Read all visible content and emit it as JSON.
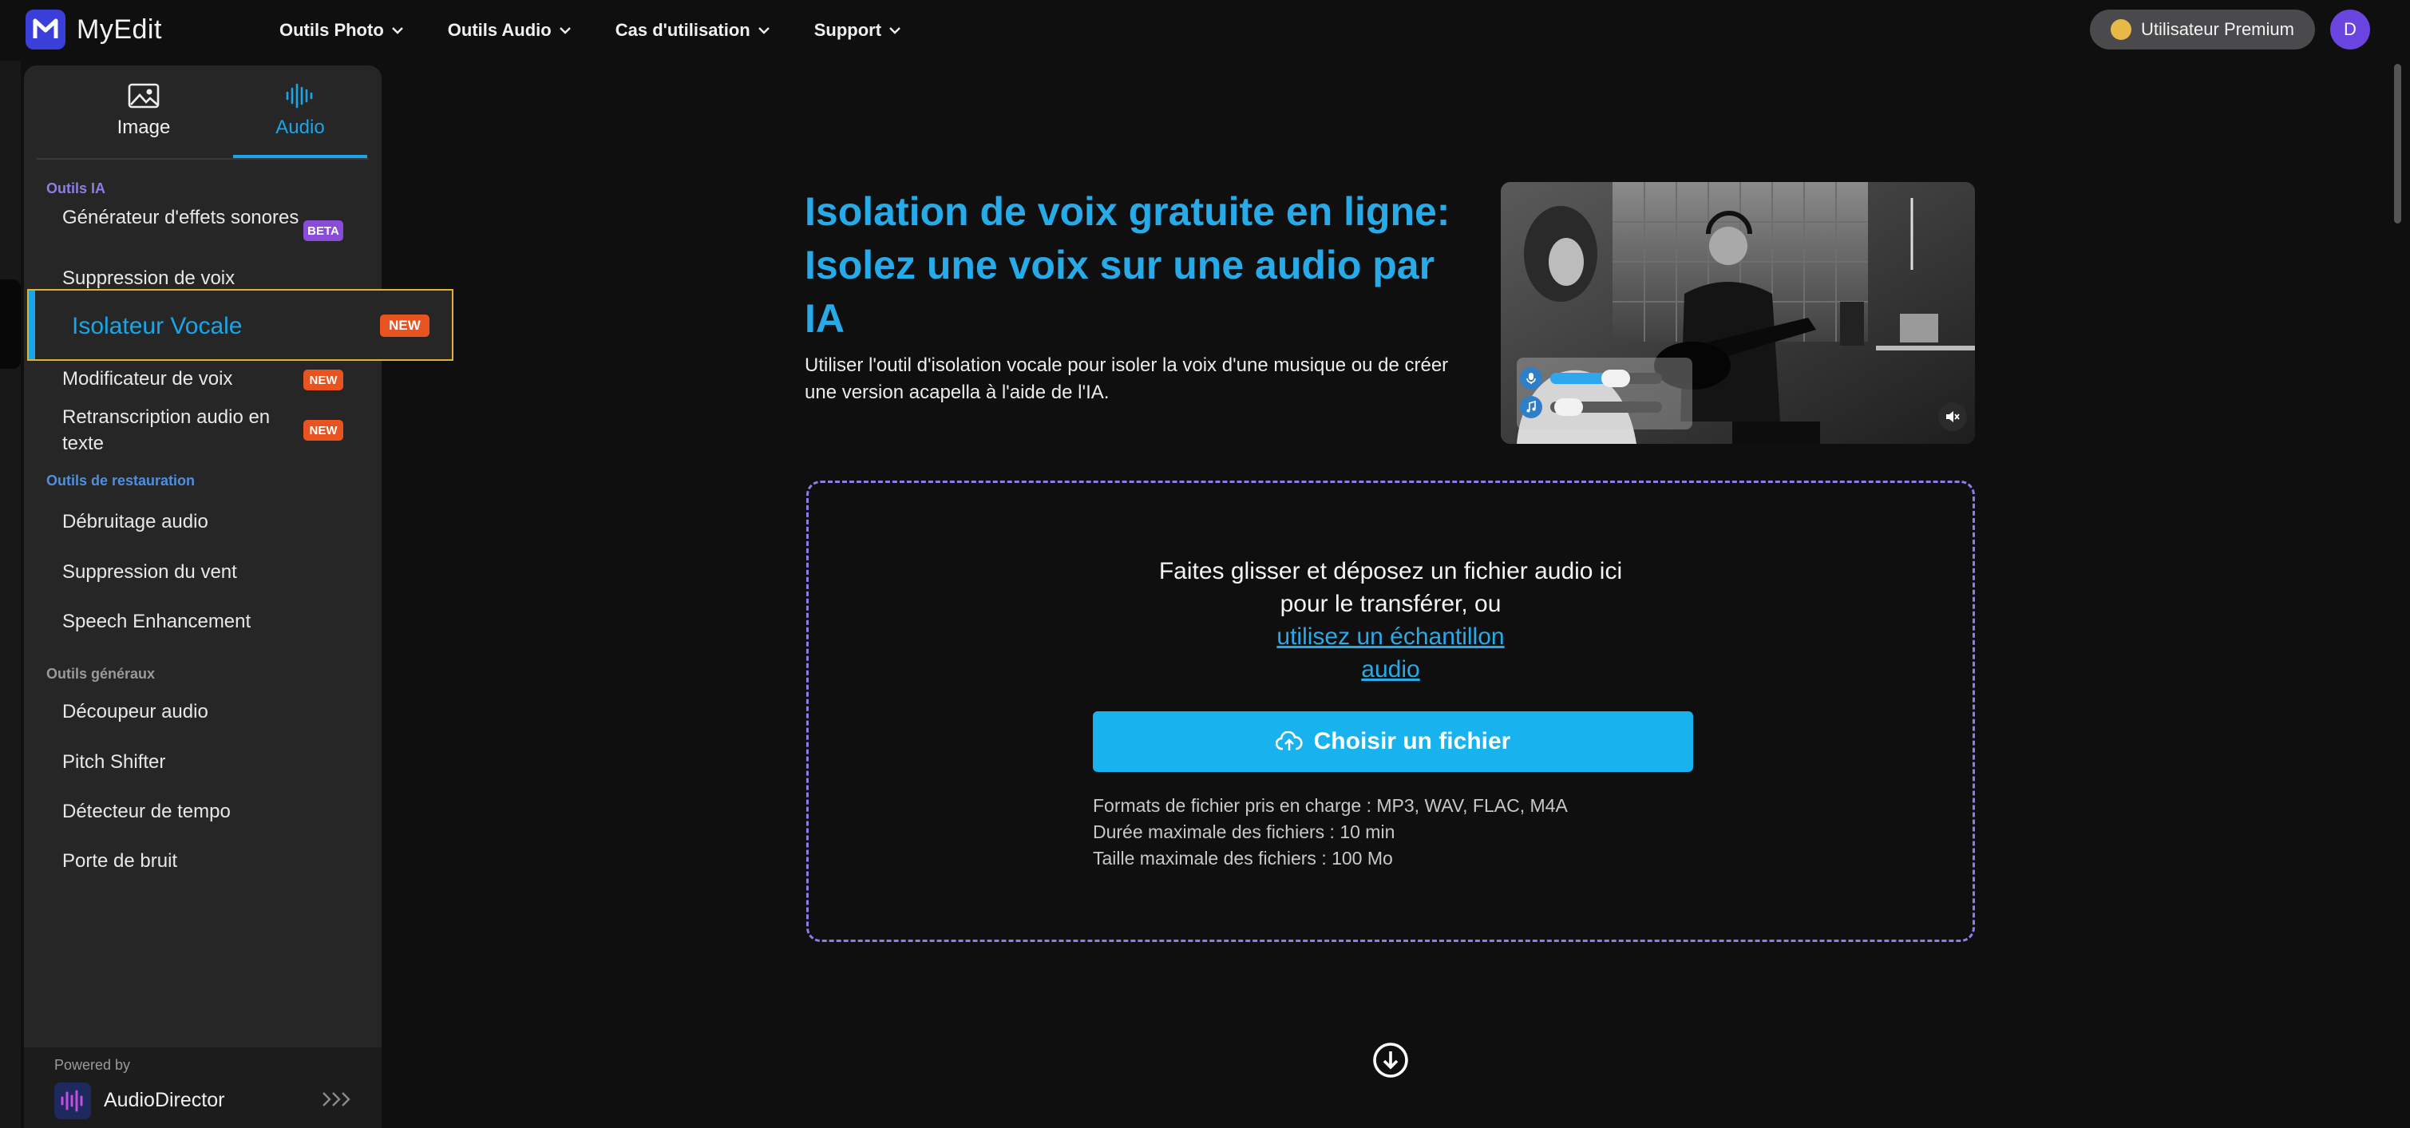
{
  "brand": {
    "name": "MyEdit"
  },
  "nav": {
    "items": [
      "Outils Photo",
      "Outils Audio",
      "Cas d'utilisation",
      "Support"
    ]
  },
  "user": {
    "premium_label": "Utilisateur Premium",
    "avatar_initial": "D"
  },
  "sidebar": {
    "tabs": [
      {
        "label": "Image",
        "icon": "image-icon"
      },
      {
        "label": "Audio",
        "icon": "waveform-icon",
        "active": true
      }
    ],
    "sections": {
      "ia": "Outils IA",
      "restoration": "Outils de restauration",
      "general": "Outils généraux"
    },
    "ia_items": [
      {
        "label": "Générateur d'effets sonores",
        "badge": "BETA"
      },
      {
        "label": "Suppression de voix"
      },
      {
        "label": "Isolateur Vocale",
        "badge": "NEW",
        "active": true
      },
      {
        "label": "Modificateur de voix",
        "badge": "NEW"
      },
      {
        "label": "Retranscription audio en texte",
        "badge": "NEW"
      }
    ],
    "restoration_items": [
      "Débruitage audio",
      "Suppression du vent",
      "Speech Enhancement"
    ],
    "general_items": [
      "Découpeur audio",
      "Pitch Shifter",
      "Détecteur de tempo",
      "Porte de bruit"
    ],
    "powered_by": {
      "label": "Powered by",
      "name": "AudioDirector"
    }
  },
  "hero": {
    "title": "Isolation de voix gratuite en ligne: Isolez une voix sur une audio par IA",
    "description": "Utiliser l'outil d'isolation vocale pour isoler la voix d'une musique ou de créer une version acapella à l'aide de l'IA.",
    "controls": {
      "vocal_level": 0.62,
      "music_level": 0.05
    }
  },
  "upload": {
    "drop_text": "Faites glisser et déposez un fichier audio ici pour le transférer, ou",
    "sample_link": "utilisez un échantillon audio",
    "button_label": "Choisir un fichier",
    "specs": [
      "Formats de fichier pris en charge : MP3, WAV, FLAC, M4A",
      "Durée maximale des fichiers : 10 min",
      "Taille maximale des fichiers : 100 Mo"
    ]
  },
  "colors": {
    "accent": "#27aae8",
    "new_badge": "#e8531f",
    "beta_badge": "#8a4bd9",
    "section_ia": "#8a7fe6",
    "section_restoration": "#4f8fe0",
    "section_general": "#9a9a9a",
    "highlight_border": "#e3b132"
  }
}
